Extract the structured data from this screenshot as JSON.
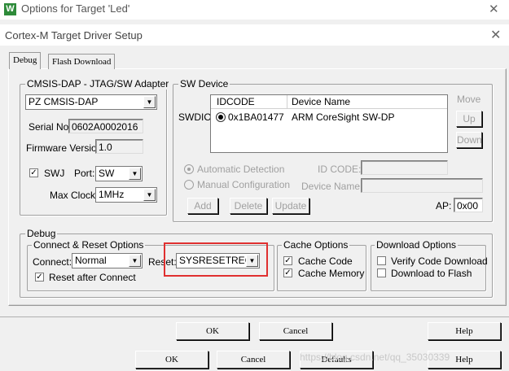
{
  "outer": {
    "title": "Options for Target 'Led'",
    "logo_letter": "W",
    "close": "✕"
  },
  "dialog": {
    "title": "Cortex-M Target Driver Setup",
    "close": "✕"
  },
  "tabs": [
    "Debug",
    "Flash Download"
  ],
  "adapter": {
    "group_label": "CMSIS-DAP - JTAG/SW Adapter",
    "selected": "PZ CMSIS-DAP",
    "serial_label": "Serial No:",
    "serial_value": "0602A0002016",
    "firmware_label": "Firmware Version:",
    "firmware_value": "1.0",
    "swj_label": "SWJ",
    "swj_checked": true,
    "port_label": "Port:",
    "port_value": "SW",
    "clock_label": "Max Clock:",
    "clock_value": "1MHz"
  },
  "sw_device": {
    "group_label": "SW Device",
    "swdio_label": "SWDIO",
    "columns": [
      "IDCODE",
      "Device Name"
    ],
    "rows": [
      {
        "idcode": "0x1BA01477",
        "name": "ARM CoreSight SW-DP"
      }
    ],
    "move_label": "Move",
    "up_label": "Up",
    "down_label": "Down",
    "auto_detect_label": "Automatic Detection",
    "manual_config_label": "Manual Configuration",
    "id_code_label": "ID CODE:",
    "device_name_label": "Device Name:",
    "add_label": "Add",
    "delete_label": "Delete",
    "update_label": "Update",
    "ap_label": "AP:",
    "ap_value": "0x00"
  },
  "debug": {
    "group_label": "Debug",
    "connect_reset": {
      "group_label": "Connect & Reset Options",
      "connect_label": "Connect:",
      "connect_value": "Normal",
      "reset_label": "Reset:",
      "reset_value": "SYSRESETREQ",
      "reset_after_connect_label": "Reset after Connect",
      "reset_after_connect_checked": true
    },
    "cache": {
      "group_label": "Cache Options",
      "cache_code_label": "Cache Code",
      "cache_code_checked": true,
      "cache_memory_label": "Cache Memory",
      "cache_memory_checked": true
    },
    "download": {
      "group_label": "Download Options",
      "verify_label": "Verify Code Download",
      "verify_checked": false,
      "flash_label": "Download to Flash",
      "flash_checked": false
    }
  },
  "inner_buttons": {
    "ok": "OK",
    "cancel": "Cancel",
    "help": "Help"
  },
  "outer_buttons": {
    "ok": "OK",
    "cancel": "Cancel",
    "defaults": "Defaults",
    "help": "Help"
  },
  "watermark": "https://blog.csdn.net/qq_35030339",
  "colors": {
    "highlight": "#e03030",
    "logo": "#2e8b3a"
  }
}
